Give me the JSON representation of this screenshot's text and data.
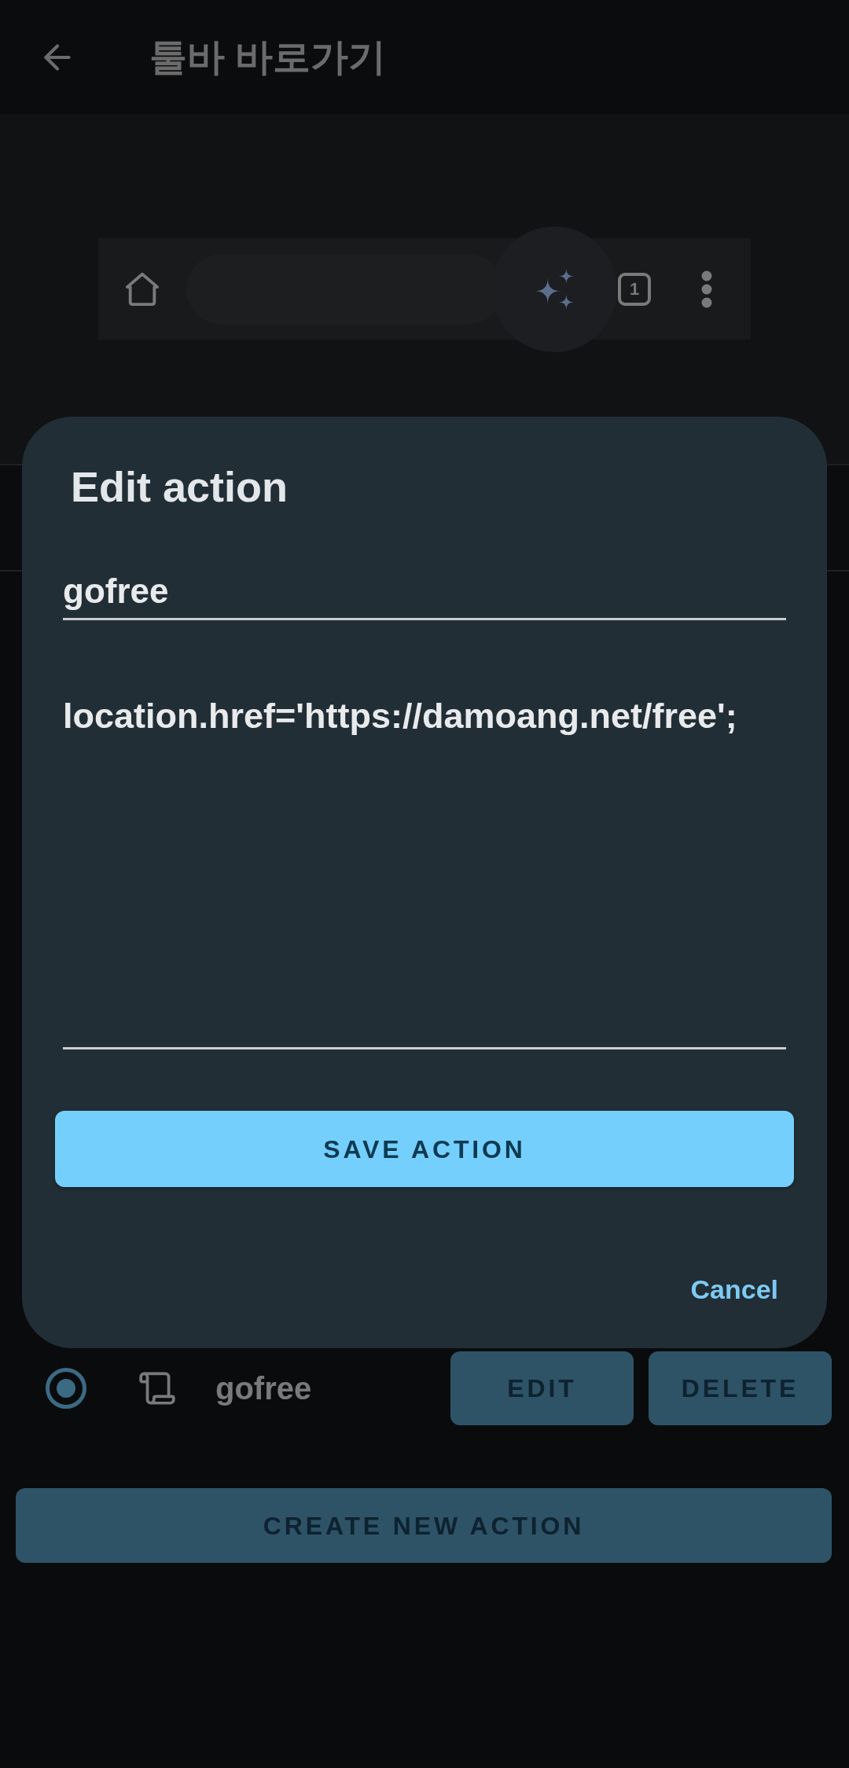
{
  "app_bar": {
    "title": "툴바 바로가기"
  },
  "toolbar_preview": {
    "tab_count": "1",
    "shortcut_highlighted": true
  },
  "dialog": {
    "title": "Edit action",
    "name_value": "gofree",
    "script_value": "location.href='https://damoang.net/free';",
    "save_button": "SAVE ACTION",
    "cancel_button": "Cancel"
  },
  "actions": [
    {
      "name": "gofree",
      "selected": true,
      "edit_button": "EDIT",
      "delete_button": "DELETE"
    }
  ],
  "create_button": "CREATE NEW ACTION"
}
